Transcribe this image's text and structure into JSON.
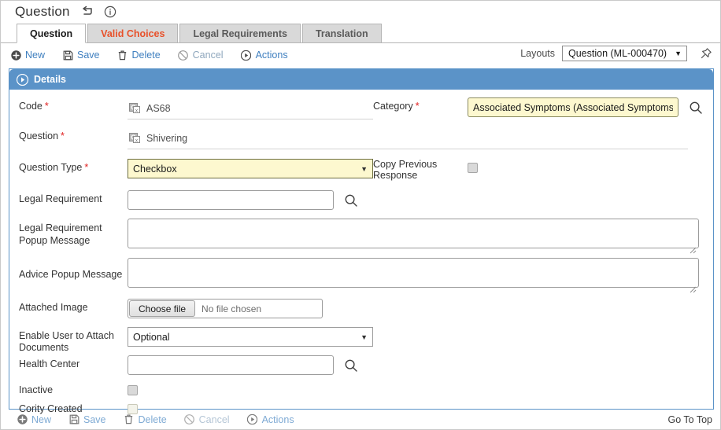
{
  "window": {
    "title": "Question",
    "title_icons": [
      {
        "name": "return-arrow-icon",
        "label": "Return"
      },
      {
        "name": "info-circle-icon",
        "label": "Info"
      }
    ]
  },
  "tabs": [
    {
      "label": "Question",
      "active": true,
      "warn": false
    },
    {
      "label": "Valid Choices",
      "active": false,
      "warn": true
    },
    {
      "label": "Legal Requirements",
      "active": false,
      "warn": false
    },
    {
      "label": "Translation",
      "active": false,
      "warn": false
    }
  ],
  "toolbar": {
    "new_label": "New",
    "save_label": "Save",
    "delete_label": "Delete",
    "cancel_label": "Cancel",
    "actions_label": "Actions"
  },
  "layouts": {
    "label": "Layouts",
    "selected": "Question (ML-000470)",
    "caret": "▼",
    "pin_icon": "pushpin-icon"
  },
  "panel": {
    "title": "Details",
    "expand_icon": "play-circle-icon"
  },
  "fields": {
    "code": {
      "label": "Code",
      "required": "*",
      "value": "AS68",
      "icon": "translation-icon"
    },
    "question": {
      "label": "Question",
      "required": "*",
      "value": "Shivering",
      "icon": "translation-icon"
    },
    "category": {
      "label": "Category",
      "required": "*",
      "value": "Associated Symptoms (Associated Symptoms)",
      "search_icon": "magnifier-icon"
    },
    "question_type": {
      "label": "Question Type",
      "required": "*",
      "value": "Checkbox",
      "caret": "▼"
    },
    "copy_previous_response": {
      "label_line1": "Copy Previous",
      "label_line2": "Response",
      "checked": false
    },
    "legal_requirement": {
      "label": "Legal Requirement",
      "value": "",
      "placeholder": "",
      "search_icon": "magnifier-icon"
    },
    "legal_requirement_popup": {
      "label_line1": "Legal Requirement",
      "label_line2": "Popup Message",
      "value": "",
      "placeholder": ""
    },
    "advice_popup": {
      "label": "Advice Popup Message",
      "value": "",
      "placeholder": ""
    },
    "attached_image": {
      "label": "Attached Image",
      "button_label": "Choose file",
      "file_status": "No file chosen"
    },
    "enable_attach_documents": {
      "label_line1": "Enable User to Attach",
      "label_line2": "Documents",
      "value": "Optional",
      "caret": "▼"
    },
    "health_center": {
      "label": "Health Center",
      "value": "",
      "placeholder": "",
      "search_icon": "magnifier-icon"
    },
    "inactive": {
      "label": "Inactive",
      "checked": false
    },
    "cority_created": {
      "label": "Cority Created",
      "checked": false
    }
  },
  "bottom": {
    "new_label": "New",
    "save_label": "Save",
    "delete_label": "Delete",
    "cancel_label": "Cancel",
    "actions_label": "Actions",
    "goto_top_label": "Go To Top"
  },
  "colors": {
    "panel_header": "#5b93c8",
    "link": "#3f7fbf",
    "required_star": "#e02020",
    "warn_tab": "#e8512a",
    "highlight_field": "#fdf8cf"
  }
}
